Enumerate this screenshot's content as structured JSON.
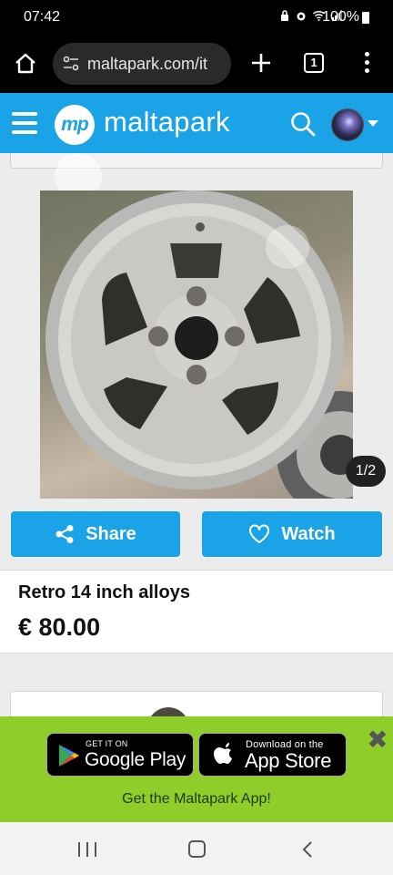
{
  "status_bar": {
    "time": "07:42",
    "battery": "100%"
  },
  "browser": {
    "url": "maltapark.com/it",
    "tab_count": "1"
  },
  "site": {
    "logo_mark": "mp",
    "logo_text": "maltapark"
  },
  "gallery": {
    "counter": "1/2"
  },
  "actions": {
    "share_label": "Share",
    "watch_label": "Watch"
  },
  "listing": {
    "title": "Retro 14 inch alloys",
    "price": "€ 80.00"
  },
  "app_banner": {
    "google_small": "GET IT ON",
    "google_big": "Google Play",
    "apple_small": "Download on the",
    "apple_big": "App Store",
    "cta": "Get the Maltapark App!",
    "close": "✖"
  },
  "colors": {
    "brand_blue": "#1ba3e8",
    "banner_green": "#8fce2a"
  },
  "icons": {
    "home": "home-icon",
    "site_info": "site-settings-icon",
    "new_tab": "plus-icon",
    "tabs": "tabs-icon",
    "menu": "more-vert-icon",
    "hamburger": "hamburger-icon",
    "search": "search-icon",
    "share": "share-icon",
    "watch": "heart-icon"
  }
}
